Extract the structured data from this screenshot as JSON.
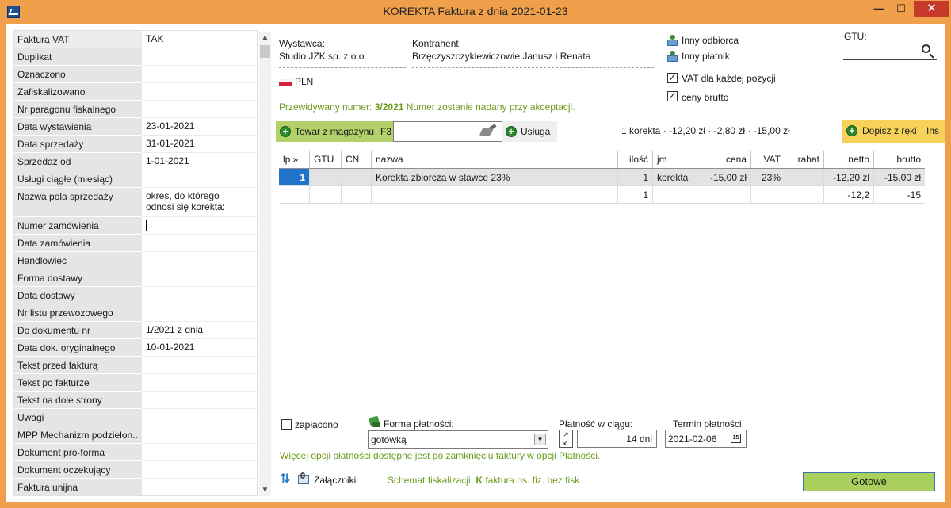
{
  "window": {
    "title": "KOREKTA Faktura z dnia 2021-01-23",
    "minimize": "—",
    "maximize": "☐",
    "close": "✕"
  },
  "left_panel": {
    "rows": [
      {
        "label": "Faktura VAT",
        "value": "TAK"
      },
      {
        "label": "Duplikat",
        "value": ""
      },
      {
        "label": "Oznaczono",
        "value": ""
      },
      {
        "label": "Zafiskalizowano",
        "value": ""
      },
      {
        "label": "Nr paragonu fiskalnego",
        "value": ""
      },
      {
        "label": "Data wystawienia",
        "value": "23-01-2021"
      },
      {
        "label": "Data sprzedaży",
        "value": "31-01-2021"
      },
      {
        "label": "Sprzedaż od",
        "value": "1-01-2021"
      },
      {
        "label": "Usługi ciągłe (miesiąc)",
        "value": ""
      },
      {
        "label": "Nazwa pola sprzedaży",
        "value": "okres, do którego\nodnosi się korekta:"
      },
      {
        "label": "Numer zamówienia",
        "value": ""
      },
      {
        "label": "Data zamówienia",
        "value": ""
      },
      {
        "label": "Handlowiec",
        "value": ""
      },
      {
        "label": "Forma dostawy",
        "value": ""
      },
      {
        "label": "Data dostawy",
        "value": ""
      },
      {
        "label": "Nr listu przewozowego",
        "value": ""
      },
      {
        "label": "Do dokumentu nr",
        "value": "1/2021 z dnia"
      },
      {
        "label": "Data dok. oryginalnego",
        "value": "10-01-2021"
      },
      {
        "label": "Tekst przed fakturą",
        "value": ""
      },
      {
        "label": "Tekst po fakturze",
        "value": ""
      },
      {
        "label": "Tekst na dole strony",
        "value": ""
      },
      {
        "label": "Uwagi",
        "value": ""
      },
      {
        "label": "MPP Mechanizm podzielon...",
        "value": ""
      },
      {
        "label": "Dokument pro-forma",
        "value": ""
      },
      {
        "label": "Dokument oczekujący",
        "value": ""
      },
      {
        "label": "Faktura unijna",
        "value": ""
      }
    ],
    "scroll_up": "▲",
    "scroll_down": "▼"
  },
  "header": {
    "wystawca_label": "Wystawca:",
    "wystawca_value": "Studio JZK sp. z o.o.",
    "kontrahent_label": "Kontrahent:",
    "kontrahent_value": "Brzęczyszczykiewiczowie Janusz i Renata",
    "currency": "PLN",
    "inny_odbiorca": "Inny odbiorca",
    "inny_platnik": "Inny płatnik",
    "vat_dla_kazdej": "VAT dla każdej pozycji",
    "ceny_brutto": "ceny brutto",
    "gtu_label": "GTU:",
    "przewidywany_label": "Przewidywany numer:",
    "przewidywany_number": "3/2021",
    "przewidywany_note": "Numer zostanie nadany przy akceptacji."
  },
  "toolbar": {
    "towar_label": "Towar z magazynu",
    "towar_shortcut": "F3",
    "usluga_label": "Usługa",
    "summary": "1 korekta · -12,20 zł · -2,80 zł · -15,00 zł",
    "dopisz_label": "Dopisz z ręki",
    "dopisz_shortcut": "Ins"
  },
  "table": {
    "headers": {
      "lp": "lp »",
      "gtu": "GTU",
      "cn": "CN",
      "nazwa": "nazwa",
      "ilosc": "ilość",
      "jm": "jm",
      "cena": "cena",
      "vat": "VAT",
      "rabat": "rabat",
      "netto": "netto",
      "brutto": "brutto"
    },
    "rows": [
      {
        "lp": "1",
        "gtu": "",
        "cn": "",
        "nazwa": "Korekta zbiorcza w stawce 23%",
        "ilosc": "1",
        "jm": "korekta",
        "cena": "-15,00 zł",
        "vat": "23%",
        "rabat": "",
        "netto": "-12,20 zł",
        "brutto": "-15,00 zł"
      },
      {
        "lp": "",
        "gtu": "",
        "cn": "",
        "nazwa": "",
        "ilosc": "1",
        "jm": "",
        "cena": "",
        "vat": "",
        "rabat": "",
        "netto": "-12,2",
        "brutto": "-15"
      }
    ]
  },
  "payment": {
    "zaplacono": "zapłacono",
    "forma_label": "Forma płatności:",
    "forma_value": "gotówką",
    "platnosc_label": "Płatność w ciągu:",
    "platnosc_value": "14 dni",
    "termin_label": "Termin płatności:",
    "termin_value": "2021-02-06",
    "note": "Więcej opcji płatności dostępne jest po zamknięciu faktury w opcji Płatności."
  },
  "footer": {
    "zalaczniki": "Załączniki",
    "schemat_label": "Schemat fiskalizacji:",
    "schemat_code": "K",
    "schemat_value": "faktura os. fiz. bez fisk.",
    "gotowe": "Gotowe"
  },
  "colors": {
    "accent_green": "#6c9a1a",
    "titlebar": "#f0a04a",
    "dopisz": "#f7d25a",
    "towar": "#b3d06a",
    "selected_lp": "#1f73c9"
  }
}
